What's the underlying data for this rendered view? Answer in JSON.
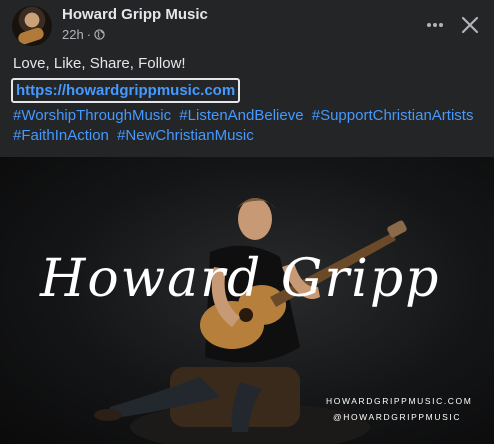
{
  "header": {
    "page_name": "Howard Gripp Music",
    "time": "22h",
    "separator": "·",
    "privacy_icon": "globe-icon",
    "more_icon": "more-horizontal-icon",
    "close_icon": "close-icon"
  },
  "post": {
    "text": "Love, Like, Share, Follow!",
    "link": "https://howardgrippmusic.com",
    "hashtags": [
      "#WorshipThroughMusic",
      "#ListenAndBelieve",
      "#SupportChristianArtists",
      "#FaithInAction",
      "#NewChristianMusic"
    ]
  },
  "media": {
    "title": "Howard Gripp",
    "website": "HOWARDGRIPPMUSIC.COM",
    "handle": "@HOWARDGRIPPMUSIC"
  },
  "colors": {
    "background": "#242526",
    "text": "#e4e6eb",
    "secondary_text": "#b0b3b8",
    "link": "#4599ff"
  }
}
